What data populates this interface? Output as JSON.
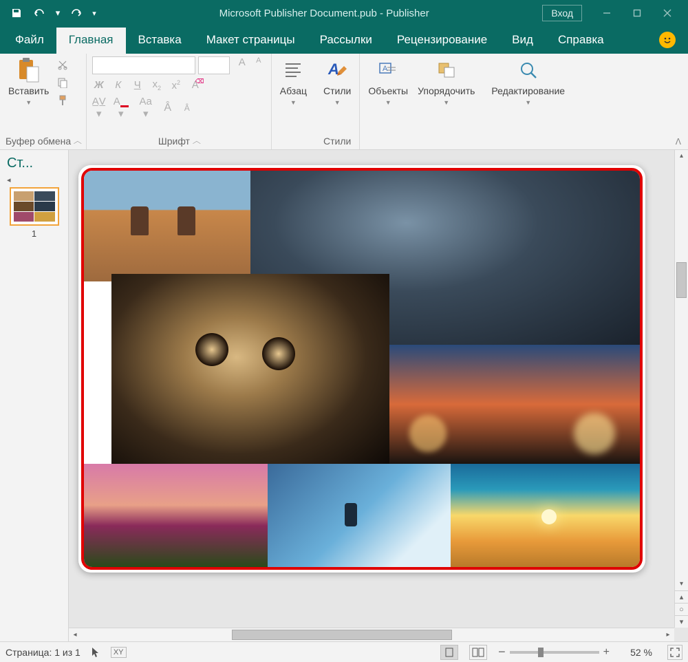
{
  "titlebar": {
    "title": "Microsoft Publisher Document.pub  -  Publisher",
    "login": "Вход"
  },
  "tabs": {
    "file": "Файл",
    "home": "Главная",
    "insert": "Вставка",
    "pagelayout": "Макет страницы",
    "mailings": "Рассылки",
    "review": "Рецензирование",
    "view": "Вид",
    "help": "Справка"
  },
  "ribbon": {
    "clipboard": {
      "paste": "Вставить",
      "label": "Буфер обмена"
    },
    "font": {
      "label": "Шрифт"
    },
    "paragraph": {
      "btn": "Абзац"
    },
    "styles": {
      "btn": "Стили",
      "label": "Стили"
    },
    "objects": {
      "btn": "Объекты"
    },
    "arrange": {
      "btn": "Упорядочить"
    },
    "editing": {
      "btn": "Редактирование"
    }
  },
  "pagepanel": {
    "title": "Ст...",
    "pageNumber": "1"
  },
  "images": {
    "desert": "desert-monuments",
    "city": "city-aerial-night",
    "cheetah": "cheetah-closeup",
    "bokeh": "bokeh-evening",
    "tulips": "tulip-field-sunset",
    "surf": "surfer-wave",
    "sunset": "ocean-sunset"
  },
  "status": {
    "page": "Страница: 1 из 1",
    "zoom": "52 %"
  }
}
